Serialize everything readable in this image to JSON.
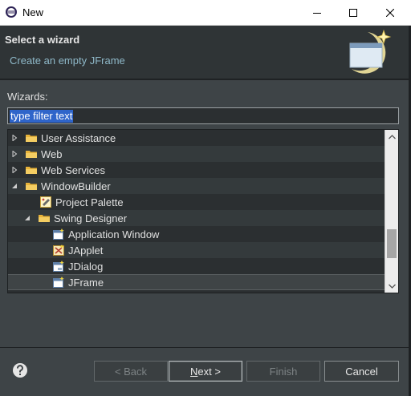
{
  "window": {
    "title": "New",
    "app_icon": "eclipse-icon",
    "controls": [
      "minimize-icon",
      "maximize-icon",
      "close-icon"
    ]
  },
  "header": {
    "title": "Select a wizard",
    "description": "Create an empty JFrame",
    "image": "wizard-banner-icon"
  },
  "wizards": {
    "label": "Wizards:",
    "filter_text": "type filter text"
  },
  "tree": {
    "items": [
      {
        "label": "User Assistance",
        "expanded": false,
        "icon": "folder-icon",
        "level": 0
      },
      {
        "label": "Web",
        "expanded": false,
        "icon": "folder-icon",
        "level": 0
      },
      {
        "label": "Web Services",
        "expanded": false,
        "icon": "folder-icon",
        "level": 0
      },
      {
        "label": "WindowBuilder",
        "expanded": true,
        "icon": "folder-icon",
        "level": 0
      },
      {
        "label": "Project Palette",
        "icon": "palette-icon",
        "level": 1
      },
      {
        "label": "Swing Designer",
        "expanded": true,
        "icon": "folder-icon",
        "level": 1
      },
      {
        "label": "Application Window",
        "icon": "window-wizard-icon",
        "level": 2
      },
      {
        "label": "JApplet",
        "icon": "applet-icon",
        "level": 2
      },
      {
        "label": "JDialog",
        "icon": "dialog-icon",
        "level": 2
      },
      {
        "label": "JFrame",
        "icon": "frame-icon",
        "level": 2,
        "selected": true
      }
    ]
  },
  "buttons": {
    "back": "< Back",
    "next_mnemonic": "N",
    "next_rest": "ext >",
    "finish": "Finish",
    "cancel": "Cancel"
  },
  "help_icon": "help-icon"
}
